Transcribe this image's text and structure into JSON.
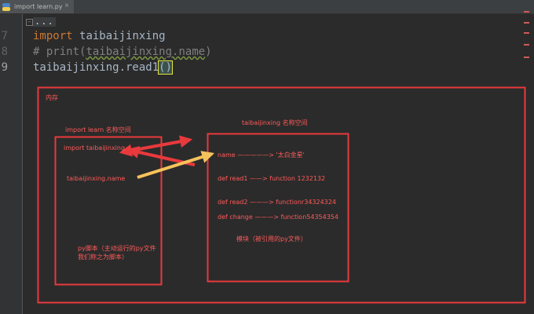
{
  "tab": {
    "filename": "import learn.py",
    "close": "×",
    "icon": "python-file-icon"
  },
  "editor": {
    "line_numbers": [
      "7",
      "8",
      "9"
    ],
    "fold_marker": "−",
    "folded": "...",
    "lines": {
      "l7_keyword": "import",
      "l7_module": "taibaijinxing",
      "l8_hash": "#",
      "l8_call": "print(",
      "l8_target": "taibaijinxing.name",
      "l8_close": ")",
      "l9_call": "taibaijinxing.read1",
      "l9_parens": "()"
    },
    "colors": {
      "keyword": "#cc7832",
      "identifier": "#a9b7c6",
      "comment": "#808080",
      "background": "#2b2b2b"
    }
  },
  "diagram": {
    "memory_label": "内存",
    "left_namespace_title": "import learn 名称空间",
    "left_items": [
      "import taibaijinxing",
      "taibaijinxing.name"
    ],
    "left_note_line1": "py脚本（主动运行的py文件",
    "left_note_line2": "我们称之为脚本）",
    "right_namespace_title": "taibaijinxing 名称空间",
    "right_items": [
      "name  —————> '太白金星'",
      "def read1 ——> function 1232132",
      "def read2 ———> functionr34324324",
      "def change ———> function54354354"
    ],
    "right_note": "模块（被引用的py文件）",
    "colors": {
      "frame": "#e8393c",
      "text": "#ff5a5a",
      "red_arrow": "#e8393c",
      "yellow_arrow": "#f5c25b"
    }
  }
}
